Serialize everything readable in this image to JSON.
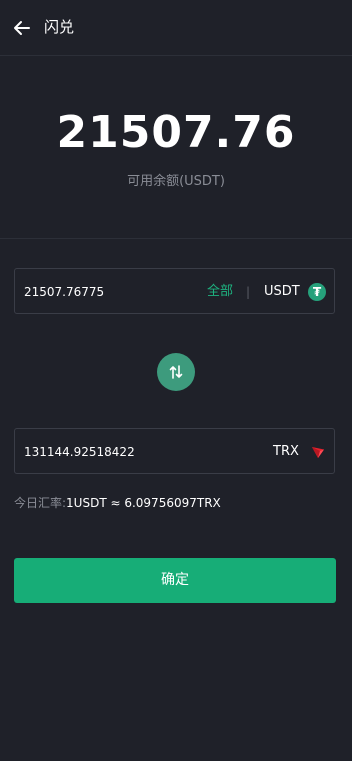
{
  "header": {
    "title": "闪兑",
    "back_icon": "arrow-left-icon"
  },
  "balance": {
    "value": "21507.76",
    "label": "可用余额(USDT)"
  },
  "from": {
    "amount": "21507.76775",
    "max_label": "全部",
    "separator": "|",
    "token": "USDT",
    "token_icon": "tether-icon"
  },
  "swap": {
    "icon": "swap-arrows-icon"
  },
  "to": {
    "amount": "131144.92518422",
    "token": "TRX",
    "token_icon": "tron-icon"
  },
  "rate": {
    "label": "今日汇率:",
    "value": "1USDT ≈ 6.09756097TRX"
  },
  "confirm": {
    "label": "确定"
  },
  "colors": {
    "background": "#1f2129",
    "accent": "#17ad77",
    "muted": "#8a8d96",
    "tron_red": "#e8212d"
  }
}
